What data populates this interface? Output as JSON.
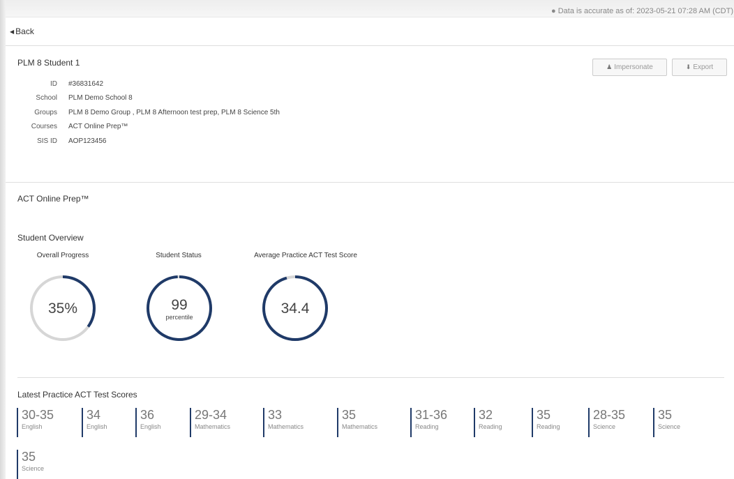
{
  "header": {
    "data_accurate": "Data is accurate as of: 2023-05-21 07:28 AM (CDT)",
    "back_label": "Back"
  },
  "student": {
    "name": "PLM 8 Student 1",
    "fields": [
      {
        "label": "ID",
        "value": "#36831642"
      },
      {
        "label": "School",
        "value": "PLM Demo School 8"
      },
      {
        "label": "Groups",
        "value": "PLM 8 Demo Group , PLM 8 Afternoon test prep, PLM 8 Science 5th"
      },
      {
        "label": "Courses",
        "value": "ACT Online Prep™"
      },
      {
        "label": "SIS ID",
        "value": "AOP123456"
      }
    ]
  },
  "actions": {
    "impersonate_label": "Impersonate",
    "export_label": "Export",
    "impersonate_icon": "user-icon",
    "export_icon": "download-icon"
  },
  "course": {
    "title": "ACT Online Prep™"
  },
  "overview": {
    "title": "Student Overview",
    "gauges": [
      {
        "label": "Overall Progress",
        "value": "35%",
        "sub": "",
        "fraction": 0.35
      },
      {
        "label": "Student Status",
        "value": "99",
        "sub": "percentile",
        "fraction": 0.99
      },
      {
        "label": "Average Practice ACT Test Score",
        "value": "34.4",
        "sub": "",
        "fraction": 0.955
      }
    ]
  },
  "colors": {
    "accent": "#1f3a68",
    "track": "#d6d6d6"
  },
  "scores": {
    "title": "Latest Practice ACT Test Scores",
    "items": [
      {
        "value": "30-35",
        "subject": "English"
      },
      {
        "value": "34",
        "subject": "English"
      },
      {
        "value": "36",
        "subject": "English"
      },
      {
        "value": "29-34",
        "subject": "Mathematics"
      },
      {
        "value": "33",
        "subject": "Mathematics"
      },
      {
        "value": "35",
        "subject": "Mathematics"
      },
      {
        "value": "31-36",
        "subject": "Reading"
      },
      {
        "value": "32",
        "subject": "Reading"
      },
      {
        "value": "35",
        "subject": "Reading"
      },
      {
        "value": "28-35",
        "subject": "Science"
      },
      {
        "value": "35",
        "subject": "Science"
      },
      {
        "value": "35",
        "subject": "Science"
      }
    ]
  }
}
